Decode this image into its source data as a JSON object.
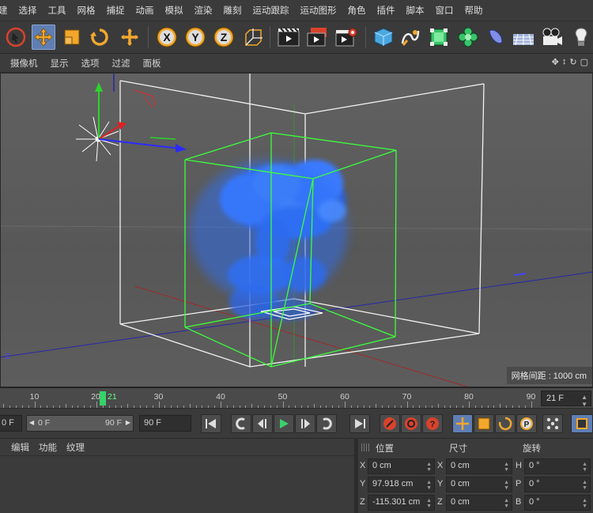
{
  "menu": [
    "建",
    "选择",
    "工具",
    "网格",
    "捕捉",
    "动画",
    "模拟",
    "渲染",
    "雕刻",
    "运动跟踪",
    "运动图形",
    "角色",
    "插件",
    "脚本",
    "窗口",
    "帮助"
  ],
  "toolbar": {
    "tools": [
      {
        "name": "select-tool-icon",
        "selected": false
      },
      {
        "name": "move-tool-icon",
        "selected": true
      },
      {
        "name": "scale-tool-icon",
        "selected": false
      },
      {
        "name": "rotate-tool-icon",
        "selected": false
      },
      {
        "name": "recent-tool-icon",
        "selected": false
      },
      {
        "name": "x-axis-lock-icon",
        "label": "X"
      },
      {
        "name": "y-axis-lock-icon",
        "label": "Y"
      },
      {
        "name": "z-axis-lock-icon",
        "label": "Z"
      },
      {
        "name": "coordinate-system-icon"
      },
      {
        "name": "render-view-icon"
      },
      {
        "name": "render-picture-viewer-icon"
      },
      {
        "name": "render-settings-icon"
      },
      {
        "name": "cube-object-icon"
      },
      {
        "name": "pen-spline-icon"
      },
      {
        "name": "subdivision-surface-icon"
      },
      {
        "name": "cloner-icon"
      },
      {
        "name": "deformer-icon"
      },
      {
        "name": "floor-scene-icon"
      },
      {
        "name": "camera-icon"
      },
      {
        "name": "light-icon"
      }
    ]
  },
  "viewport_menu": [
    "摄像机",
    "显示",
    "选项",
    "过滤",
    "面板"
  ],
  "viewport": {
    "grid_spacing_label": "网格间距 : 1000 cm",
    "smoke_color": "#3b7dff",
    "bbox_color": "#3cff3c"
  },
  "timeline": {
    "ticks": [
      10,
      20,
      30,
      40,
      50,
      60,
      70,
      80,
      90
    ],
    "current_frame_marker": "21",
    "current_frame": "21 F"
  },
  "playback": {
    "start_field": "0 F",
    "range_min": "0 F",
    "range_max": "90 F",
    "end_field": "90 F"
  },
  "attributes_menu": [
    "编辑",
    "功能",
    "纹理"
  ],
  "coordinates": {
    "headers": {
      "position": "位置",
      "size": "尺寸",
      "rotation": "旋转"
    },
    "rows": [
      {
        "pos_axis": "X",
        "pos": "0 cm",
        "size_axis": "X",
        "size": "0 cm",
        "rot_axis": "H",
        "rot": "0 °"
      },
      {
        "pos_axis": "Y",
        "pos": "97.918 cm",
        "size_axis": "Y",
        "size": "0 cm",
        "rot_axis": "P",
        "rot": "0 °"
      },
      {
        "pos_axis": "Z",
        "pos": "-115.301 cm",
        "size_axis": "Z",
        "size": "0 cm",
        "rot_axis": "B",
        "rot": "0 °"
      }
    ]
  },
  "colors": {
    "accent": "#5f7eb3",
    "playhead": "#38d26a",
    "axis_x": "#e02020",
    "axis_y": "#2ad42a",
    "axis_z": "#2b2bff"
  }
}
